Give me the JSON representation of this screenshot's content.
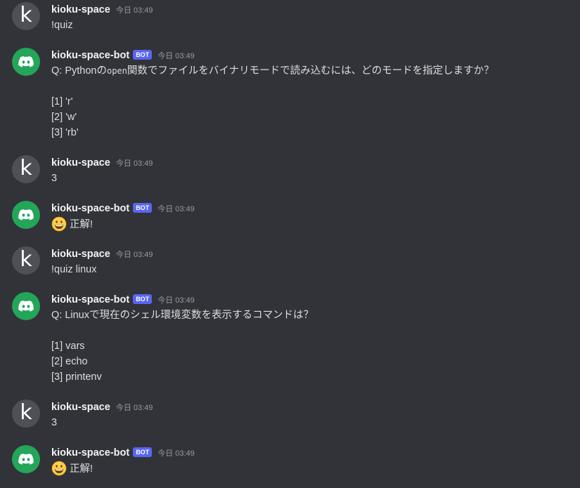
{
  "messages": [
    {
      "author": "kioku-space",
      "avatar_letter": "k",
      "timestamp": "今日 03:49",
      "lines": [
        "!quiz"
      ]
    },
    {
      "author": "kioku-space-bot",
      "badge": "BOT",
      "timestamp": "今日 03:49",
      "question_prefix": "Q: Pythonの",
      "question_code": "open",
      "question_suffix": "関数でファイルをバイナリモードで読み込むには、どのモードを指定しますか？",
      "options": [
        "[1] 'r'",
        "[2] 'w'",
        "[3] 'rb'"
      ]
    },
    {
      "author": "kioku-space",
      "avatar_letter": "k",
      "timestamp": "今日 03:49",
      "lines": [
        "3"
      ]
    },
    {
      "author": "kioku-space-bot",
      "badge": "BOT",
      "timestamp": "今日 03:49",
      "emoji": "grinning-face-icon",
      "text": "正解!"
    },
    {
      "author": "kioku-space",
      "avatar_letter": "k",
      "timestamp": "今日 03:49",
      "lines": [
        "!quiz linux"
      ]
    },
    {
      "author": "kioku-space-bot",
      "badge": "BOT",
      "timestamp": "今日 03:49",
      "question": "Q: Linuxで現在のシェル環境変数を表示するコマンドは？",
      "options": [
        "[1] vars",
        "[2] echo",
        "[3] printenv"
      ]
    },
    {
      "author": "kioku-space",
      "avatar_letter": "k",
      "timestamp": "今日 03:49",
      "lines": [
        "3"
      ]
    },
    {
      "author": "kioku-space-bot",
      "badge": "BOT",
      "timestamp": "今日 03:49",
      "emoji": "grinning-face-icon",
      "text": "正解!"
    }
  ],
  "colors": {
    "background": "#313338",
    "bot_avatar": "#23a55a",
    "user_avatar": "#4e5058",
    "bot_badge": "#5865f2"
  }
}
